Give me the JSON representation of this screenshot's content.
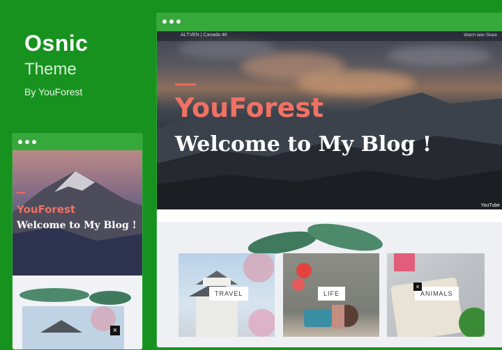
{
  "brand": {
    "name": "Osnic",
    "subtitle": "Theme",
    "byline": "By YouForest"
  },
  "desktop": {
    "video_title": "ALTVEN | Canada 4K",
    "video_links": "Watch later   Share",
    "video_logo": "YouTube",
    "hero_brand": "YouForest",
    "hero_welcome": "Welcome to My Blog !",
    "cards": [
      {
        "tag": "TRAVEL"
      },
      {
        "tag": "LIFE"
      },
      {
        "tag": "ANIMALS"
      }
    ],
    "close_glyph": "×"
  },
  "mobile": {
    "hero_brand": "YouForest",
    "hero_welcome": "Welcome to My Blog !",
    "close_glyph": "×"
  },
  "colors": {
    "background": "#17921f",
    "accent": "#f06a5b"
  }
}
